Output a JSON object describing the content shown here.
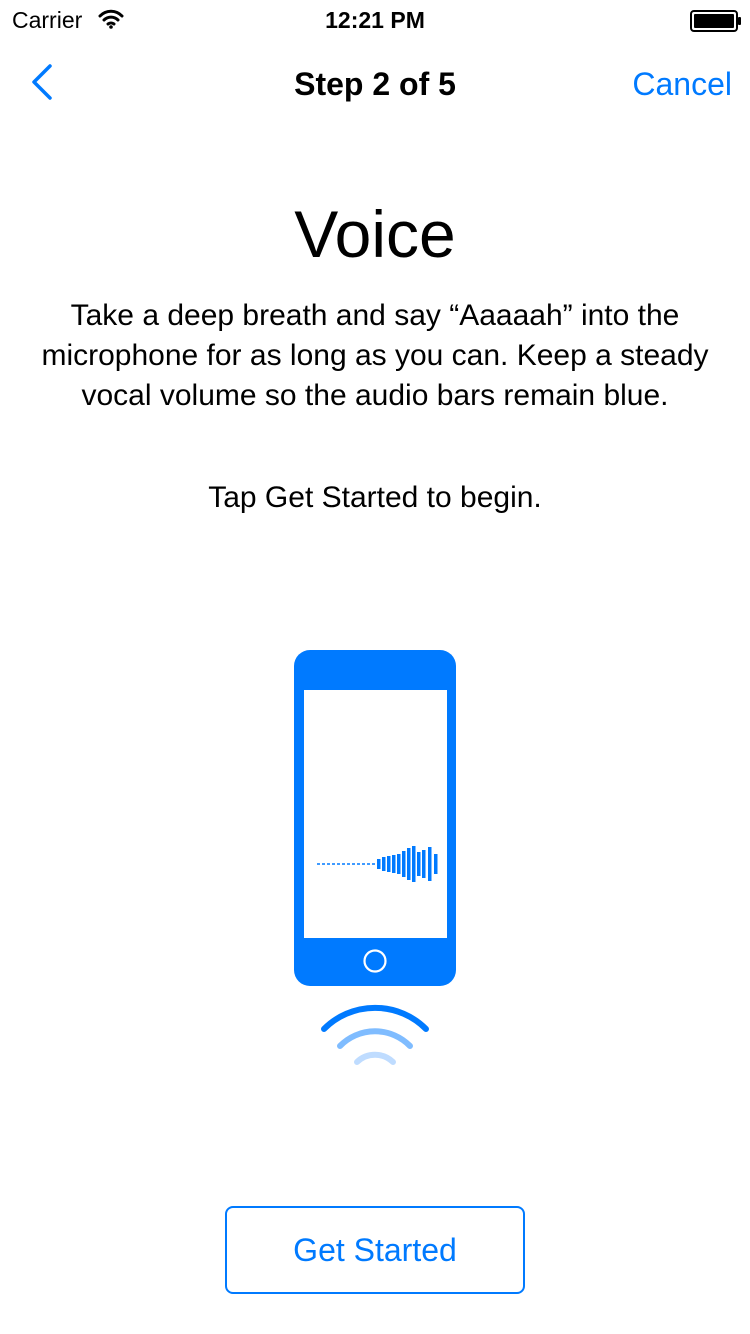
{
  "status_bar": {
    "carrier": "Carrier",
    "time": "12:21 PM",
    "icons": [
      "wifi-icon",
      "battery-icon"
    ]
  },
  "nav": {
    "back_icon": "chevron-left-icon",
    "title": "Step 2 of 5",
    "cancel_label": "Cancel"
  },
  "content": {
    "title": "Voice",
    "body": "Take a deep breath and say “Aaaaah” into the microphone for as long as you can. Keep a steady vocal volume so the audio bars remain blue.",
    "instruction": "Tap Get Started to begin.",
    "illustration_icons": [
      "phone-icon",
      "audio-bars-icon",
      "sound-waves-icon"
    ]
  },
  "actions": {
    "get_started_label": "Get Started"
  },
  "colors": {
    "accent": "#007aff",
    "wave_mid": "#7fbcff",
    "wave_light": "#bfdcff",
    "text": "#000000",
    "background": "#ffffff"
  }
}
